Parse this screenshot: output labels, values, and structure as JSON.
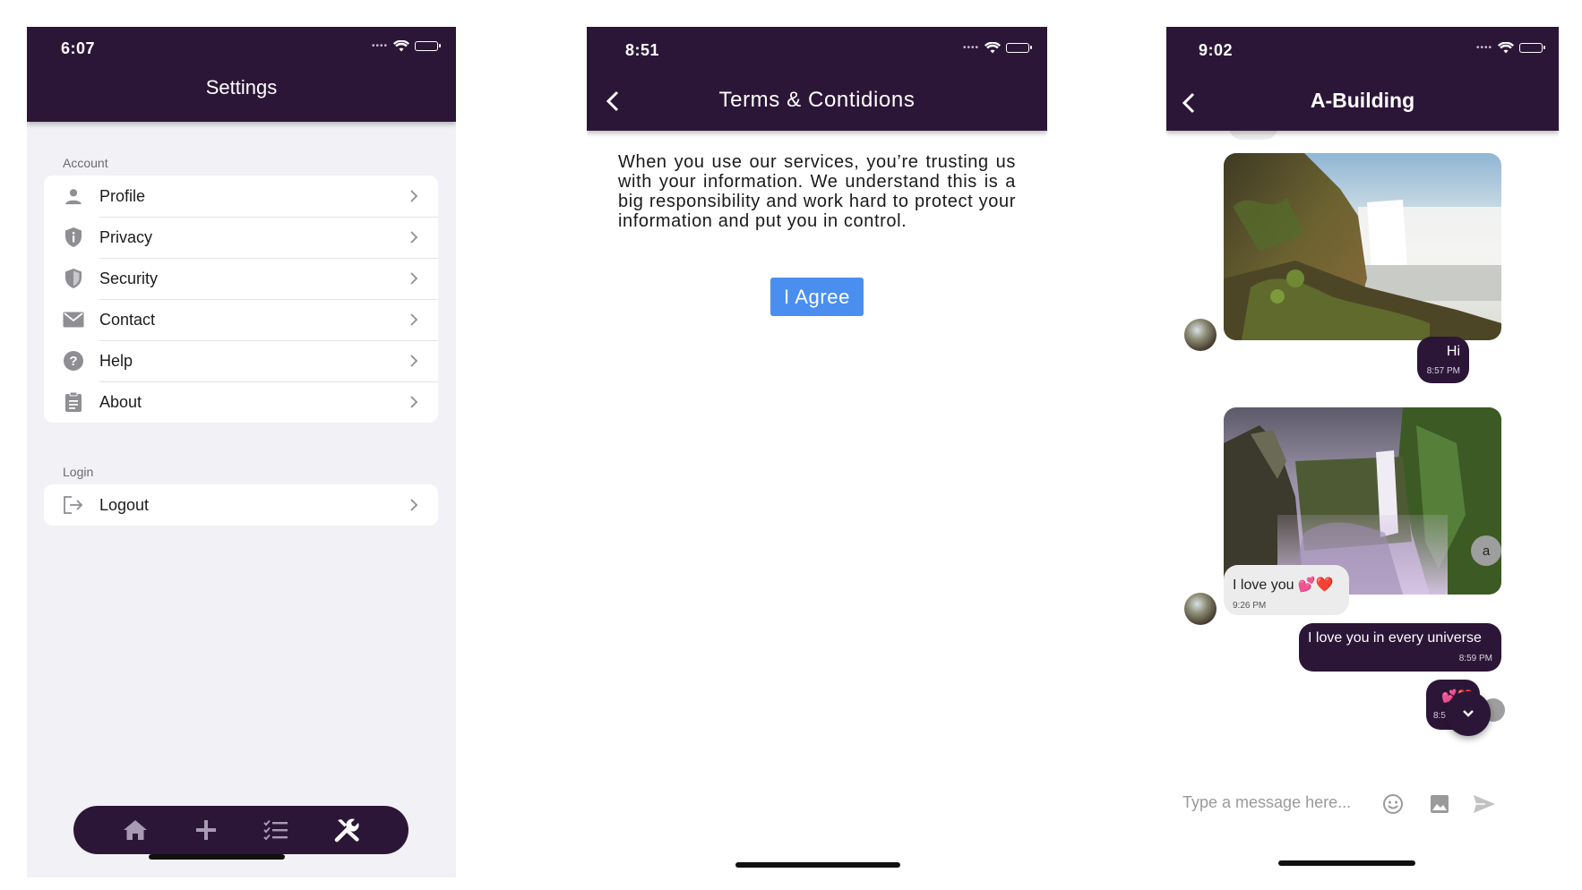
{
  "settings_screen": {
    "status_time": "6:07",
    "title": "Settings",
    "sections": [
      {
        "label": "Account",
        "items": [
          {
            "label": "Profile",
            "icon": "person-icon"
          },
          {
            "label": "Privacy",
            "icon": "info-shield-icon"
          },
          {
            "label": "Security",
            "icon": "shield-icon"
          },
          {
            "label": "Contact",
            "icon": "mail-icon"
          },
          {
            "label": "Help",
            "icon": "help-icon"
          },
          {
            "label": "About",
            "icon": "clipboard-icon"
          }
        ]
      },
      {
        "label": "Login",
        "items": [
          {
            "label": "Logout",
            "icon": "logout-icon"
          }
        ]
      }
    ],
    "tabbar": [
      "home-icon",
      "plus-icon",
      "checklist-icon",
      "tools-icon"
    ],
    "active_tab": "tools-icon"
  },
  "terms_screen": {
    "status_time": "8:51",
    "title": "Terms & Contidions",
    "body": "When you use our services, you’re trusting us with your information. We understand this is a big responsibility and work hard to protect your information and put you in control.",
    "agree_label": "I Agree"
  },
  "chat_screen": {
    "status_time": "9:02",
    "title": "A-Building",
    "messages": [
      {
        "type": "image",
        "direction": "in",
        "image": "waterfall-cliff-photo"
      },
      {
        "type": "text",
        "direction": "out",
        "text": "Hi",
        "time": "8:57 PM"
      },
      {
        "type": "image",
        "direction": "out",
        "image": "waterfall-canyon-photo"
      },
      {
        "type": "text",
        "direction": "in",
        "text": "I love you 💕❤️",
        "time": "9:26 PM"
      },
      {
        "type": "text",
        "direction": "out",
        "text": "I love you in every universe",
        "time": "8:59 PM"
      },
      {
        "type": "text",
        "direction": "out",
        "text": "💕❤️",
        "time": "8:59 P"
      }
    ],
    "sender_avatar_letter": "a",
    "composer_placeholder": "Type a message here..."
  },
  "colors": {
    "brand_purple": "#2c1638",
    "button_blue": "#4a8ff0",
    "settings_background": "#f2f1f6"
  }
}
